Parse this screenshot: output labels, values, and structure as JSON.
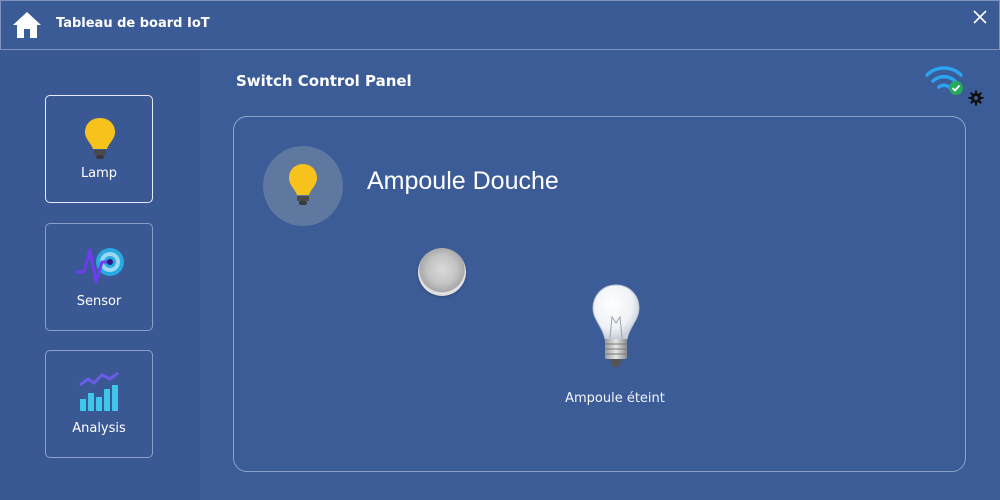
{
  "window": {
    "title": "Tableau de board IoT",
    "home_icon": "home-icon",
    "close_icon": "close-icon"
  },
  "sidebar": {
    "items": [
      {
        "label": "Lamp",
        "icon": "lightbulb-icon",
        "active": true
      },
      {
        "label": "Sensor",
        "icon": "sensor-pulse-icon",
        "active": false
      },
      {
        "label": "Analysis",
        "icon": "chart-analysis-icon",
        "active": false
      }
    ]
  },
  "main": {
    "panel_title": "Switch Control Panel",
    "connection_icon": "wifi-connected-icon",
    "settings_icon": "gear-icon",
    "device": {
      "name": "Ampoule Douche",
      "icon": "lightbulb-icon",
      "switch_state": "off",
      "status_text": "Ampoule éteint",
      "status_icon": "lightbulb-off-icon"
    }
  },
  "colors": {
    "background": "#3a5a95",
    "bulb_yellow": "#f7c21b",
    "wifi_blue": "#2aa3f0",
    "check_green": "#27a85a"
  }
}
